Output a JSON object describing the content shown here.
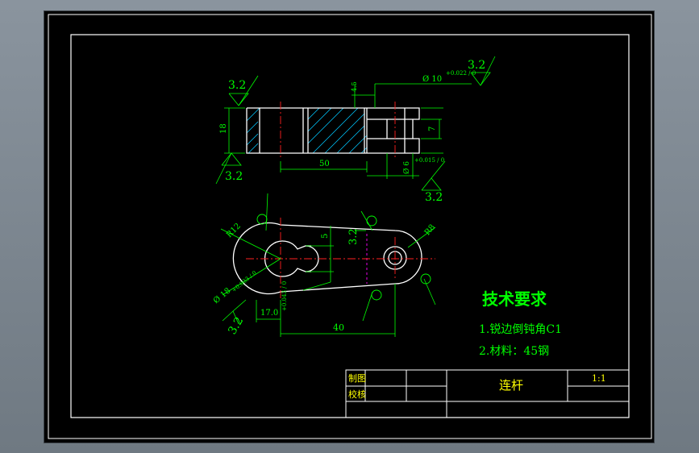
{
  "colors": {
    "background": "#000000",
    "border": "#ffffff",
    "outline": "#ffffff",
    "dimension": "#00ff00",
    "centerline": "#ff2020",
    "hatch": "#00c8ff",
    "construction": "#ff00ff",
    "title_text": "#ffff00"
  },
  "dimensions": {
    "roughness_3_2": "3.2",
    "height_18": "18",
    "length_50": "50",
    "hole_10": "Ø 10",
    "hole_10_tol": "+0.022 / 0",
    "pin_6": "Ø 6",
    "pin_6_tol": "+0.015 / 0",
    "slot_7": "7",
    "depth_4_5": "4.5",
    "radius_r12": "R12",
    "radius_r8": "R8",
    "bore_18": "Ø 18",
    "bore_18_tol": "+0.033 / 0",
    "offset_17": "17.0",
    "offset_17_tol": "+0.043 / 0",
    "span_40": "40",
    "slot_5": "5",
    "roughness_v1": "3.2"
  },
  "notes": {
    "title": "技术要求",
    "items": [
      "1.锐边倒钝角C1",
      "2.材料：45钢"
    ]
  },
  "title_block": {
    "drawn_label": "制图",
    "checked_label": "校核",
    "part_name": "连杆",
    "scale": "1:1"
  }
}
